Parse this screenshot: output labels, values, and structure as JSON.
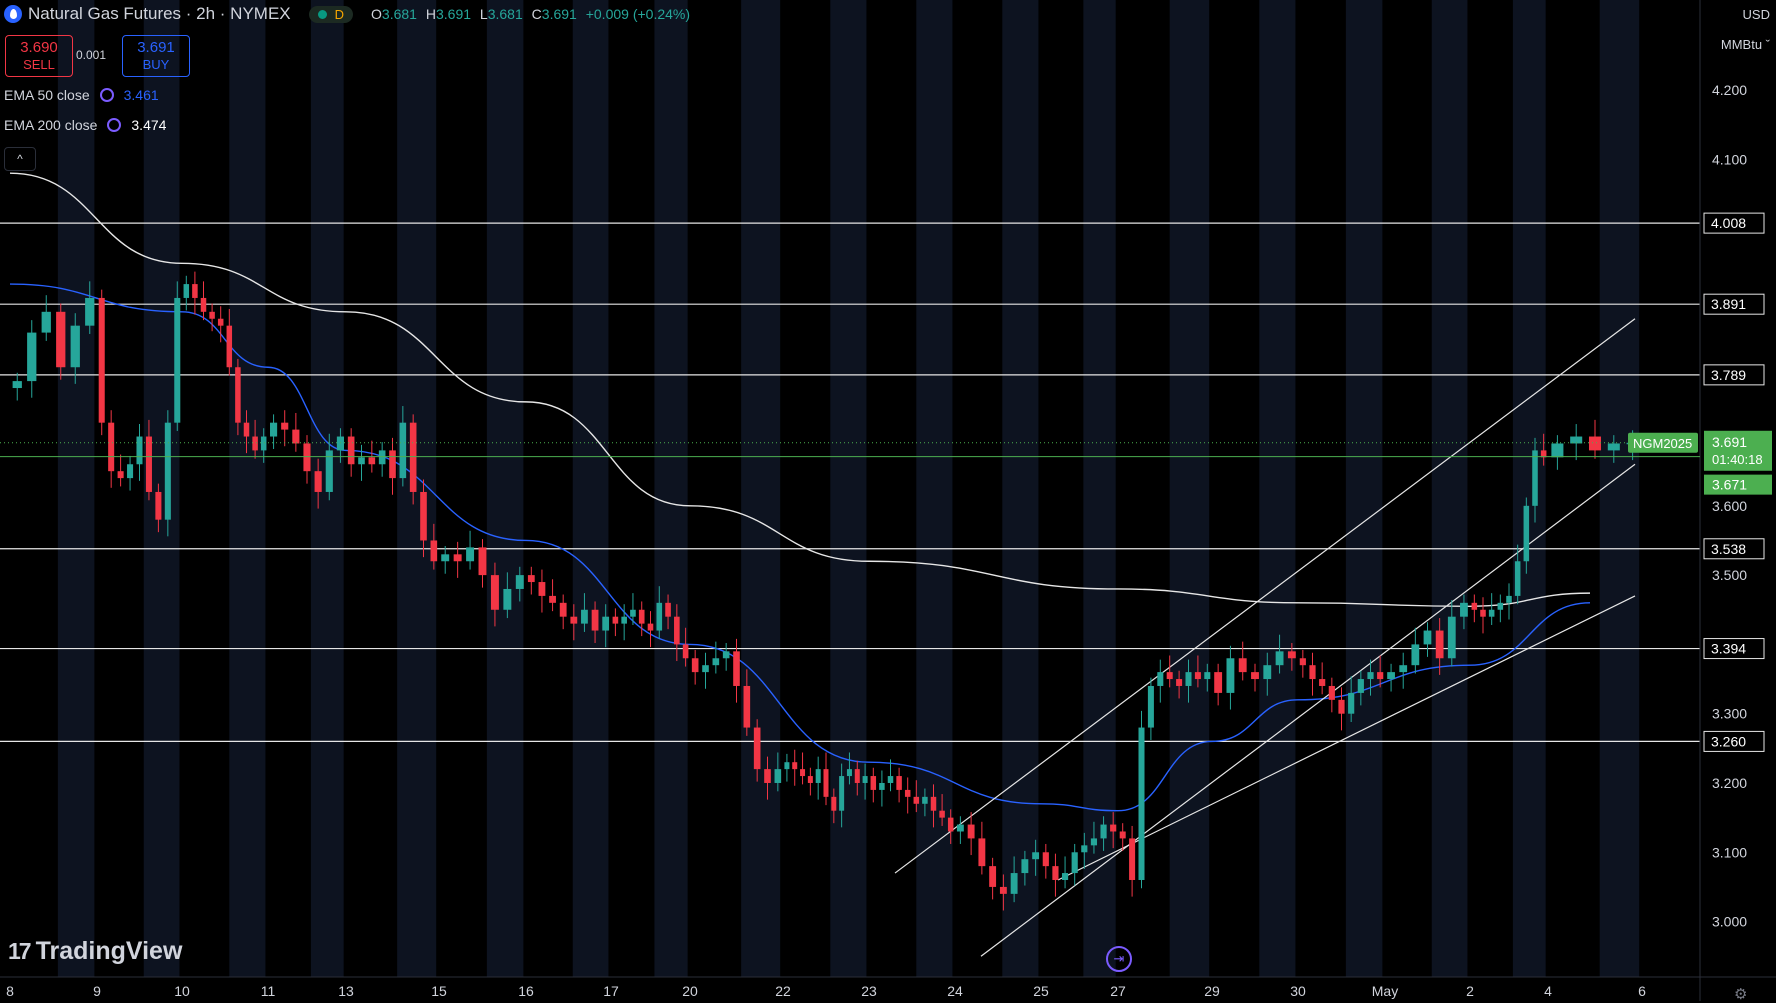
{
  "header": {
    "title": "Natural Gas Futures · 2h · NYMEX",
    "status_label": "D",
    "ohlc": [
      {
        "label": "O",
        "value": "3.681"
      },
      {
        "label": "H",
        "value": "3.691"
      },
      {
        "label": "L",
        "value": "3.681"
      },
      {
        "label": "C",
        "value": "3.691"
      },
      {
        "label": "",
        "value": "+0.009 (+0.24%)"
      }
    ]
  },
  "trade": {
    "sell_price": "3.690",
    "sell_label": "SELL",
    "buy_price": "3.691",
    "buy_label": "BUY",
    "spread": "0.001"
  },
  "indicators": [
    {
      "label": "EMA 50 close",
      "value": "3.461",
      "color": "#2962ff"
    },
    {
      "label": "EMA 200 close",
      "value": "3.474",
      "color": "#ffffff"
    }
  ],
  "collapse_icon": "^",
  "axis": {
    "currency": "USD",
    "unit": "MMBtu ˇ"
  },
  "logo": {
    "text": "TradingView",
    "mark": "17"
  },
  "bubble_icon": "⇥",
  "settings_icon": "⚙",
  "colors": {
    "up": "#26a69a",
    "down": "#f23645",
    "ema50": "#2962ff",
    "ema200": "#e6e6e6",
    "last_price": "#4caf50"
  },
  "chart_data": {
    "type": "candlestick",
    "interval": "2h",
    "ylim": [
      2.92,
      4.33
    ],
    "y_ticks": [
      "3.000",
      "3.100",
      "3.200",
      "3.300",
      "3.500",
      "3.600",
      "4.100",
      "4.200"
    ],
    "x_ticks": [
      "8",
      "9",
      "10",
      "11",
      "13",
      "15",
      "16",
      "17",
      "20",
      "22",
      "23",
      "24",
      "25",
      "27",
      "29",
      "30",
      "May",
      "2",
      "4",
      "6"
    ],
    "horizontal_levels": [
      {
        "value": 4.008,
        "label": "4.008"
      },
      {
        "value": 3.891,
        "label": "3.891"
      },
      {
        "value": 3.789,
        "label": "3.789"
      },
      {
        "value": 3.538,
        "label": "3.538"
      },
      {
        "value": 3.394,
        "label": "3.394"
      },
      {
        "value": 3.26,
        "label": "3.260"
      }
    ],
    "last_price": {
      "symbol": "NGM2025",
      "value": 3.691,
      "label": "3.691",
      "countdown": "01:40:18",
      "level_value": 3.671,
      "level_label": "3.671"
    },
    "channel_lines": [
      {
        "from": [
          "24",
          3.07
        ],
        "to": [
          "5",
          3.87
        ]
      },
      {
        "from": [
          "25",
          2.95
        ],
        "to": [
          "5",
          3.66
        ]
      },
      {
        "from": [
          "27",
          3.06
        ],
        "to": [
          "5",
          3.47
        ]
      }
    ],
    "close_series": [
      {
        "date": "8",
        "values": [
          3.78,
          3.85,
          3.88,
          3.8,
          3.86,
          3.9
        ]
      },
      {
        "date": "9",
        "values": [
          3.72,
          3.65,
          3.64,
          3.66,
          3.7,
          3.62,
          3.58,
          3.72,
          3.9
        ]
      },
      {
        "date": "10",
        "values": [
          3.92,
          3.9,
          3.88,
          3.87,
          3.86,
          3.8,
          3.72,
          3.7,
          3.68,
          3.7
        ]
      },
      {
        "date": "11",
        "values": [
          3.72,
          3.71,
          3.69,
          3.65,
          3.62,
          3.68,
          3.7
        ]
      },
      {
        "date": "13",
        "values": [
          3.66,
          3.67,
          3.66,
          3.68,
          3.64,
          3.72,
          3.62,
          3.55,
          3.52
        ]
      },
      {
        "date": "15",
        "values": [
          3.53,
          3.52,
          3.54,
          3.5,
          3.45,
          3.48,
          3.5
        ]
      },
      {
        "date": "16",
        "values": [
          3.49,
          3.47,
          3.46,
          3.44,
          3.43,
          3.45,
          3.42,
          3.44
        ]
      },
      {
        "date": "17",
        "values": [
          3.43,
          3.44,
          3.45,
          3.43,
          3.42,
          3.46,
          3.44,
          3.4,
          3.38
        ]
      },
      {
        "date": "20",
        "values": [
          3.36,
          3.37,
          3.38,
          3.39,
          3.34,
          3.28,
          3.22,
          3.2,
          3.22
        ]
      },
      {
        "date": "22",
        "values": [
          3.23,
          3.22,
          3.21,
          3.2,
          3.22,
          3.18,
          3.16,
          3.21,
          3.22,
          3.2,
          3.21
        ]
      },
      {
        "date": "23",
        "values": [
          3.19,
          3.2,
          3.21,
          3.19,
          3.18,
          3.17,
          3.18,
          3.16,
          3.15,
          3.13
        ]
      },
      {
        "date": "24",
        "values": [
          3.14,
          3.12,
          3.08,
          3.05,
          3.04,
          3.07,
          3.09,
          3.1
        ]
      },
      {
        "date": "25",
        "values": [
          3.08,
          3.06,
          3.07,
          3.1,
          3.11,
          3.12,
          3.14,
          3.13
        ]
      },
      {
        "date": "27",
        "values": [
          3.12,
          3.06,
          3.28,
          3.34,
          3.36,
          3.35,
          3.34,
          3.36,
          3.35,
          3.36
        ]
      },
      {
        "date": "29",
        "values": [
          3.33,
          3.38,
          3.36,
          3.35,
          3.37,
          3.39,
          3.38
        ]
      },
      {
        "date": "30",
        "values": [
          3.37,
          3.35,
          3.34,
          3.32,
          3.3,
          3.33,
          3.35,
          3.36,
          3.35
        ]
      },
      {
        "date": "May",
        "values": [
          3.36,
          3.37,
          3.4,
          3.42,
          3.38,
          3.44,
          3.46
        ]
      },
      {
        "date": "2",
        "values": [
          3.45,
          3.44,
          3.45,
          3.46,
          3.47,
          3.52,
          3.6,
          3.68,
          3.67
        ]
      },
      {
        "date": "4",
        "values": [
          3.69,
          3.7,
          3.68,
          3.69,
          3.691
        ]
      }
    ],
    "ema50": [
      [
        3.92,
        "8"
      ],
      [
        3.88,
        "10"
      ],
      [
        3.8,
        "11"
      ],
      [
        3.68,
        "13"
      ],
      [
        3.55,
        "16"
      ],
      [
        3.4,
        "20"
      ],
      [
        3.23,
        "23"
      ],
      [
        3.17,
        "25"
      ],
      [
        3.16,
        "27"
      ],
      [
        3.26,
        "29"
      ],
      [
        3.32,
        "30"
      ],
      [
        3.37,
        "2"
      ],
      [
        3.46,
        "5"
      ]
    ],
    "ema200": [
      [
        4.08,
        "8"
      ],
      [
        3.95,
        "10"
      ],
      [
        3.88,
        "13"
      ],
      [
        3.75,
        "16"
      ],
      [
        3.6,
        "20"
      ],
      [
        3.52,
        "23"
      ],
      [
        3.48,
        "27"
      ],
      [
        3.46,
        "30"
      ],
      [
        3.455,
        "2"
      ],
      [
        3.474,
        "5"
      ]
    ]
  }
}
